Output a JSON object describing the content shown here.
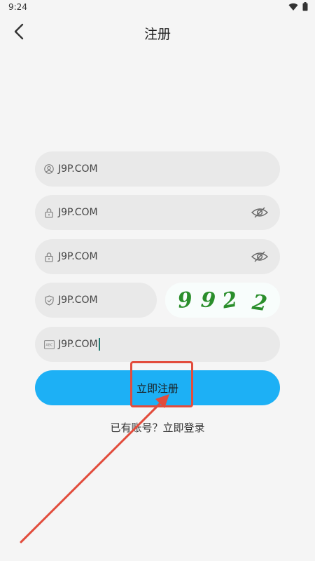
{
  "status_bar": {
    "time": "9:24",
    "icons": [
      "wifi-icon",
      "battery-icon"
    ]
  },
  "header": {
    "title": "注册",
    "back_icon": "chevron-left-icon"
  },
  "form": {
    "username": {
      "value": "J9P.COM",
      "icon": "user-icon"
    },
    "password": {
      "value": "J9P.COM",
      "icon": "lock-icon",
      "toggle_icon": "eye-off-icon"
    },
    "confirm_password": {
      "value": "J9P.COM",
      "icon": "lock-icon",
      "toggle_icon": "eye-off-icon"
    },
    "captcha_input": {
      "value": "J9P.COM",
      "icon": "shield-icon"
    },
    "invite_code": {
      "value": "J9P.COM",
      "icon": "abc-icon"
    }
  },
  "captcha_image": {
    "digits": [
      "9",
      "9",
      "2",
      "2"
    ],
    "color": "#2a8e2b"
  },
  "register_button": {
    "label": "立即注册",
    "color": "#1db0f5"
  },
  "login_link": {
    "label": "已有账号？立即登录"
  },
  "annotation": {
    "color": "#e24c3c"
  }
}
